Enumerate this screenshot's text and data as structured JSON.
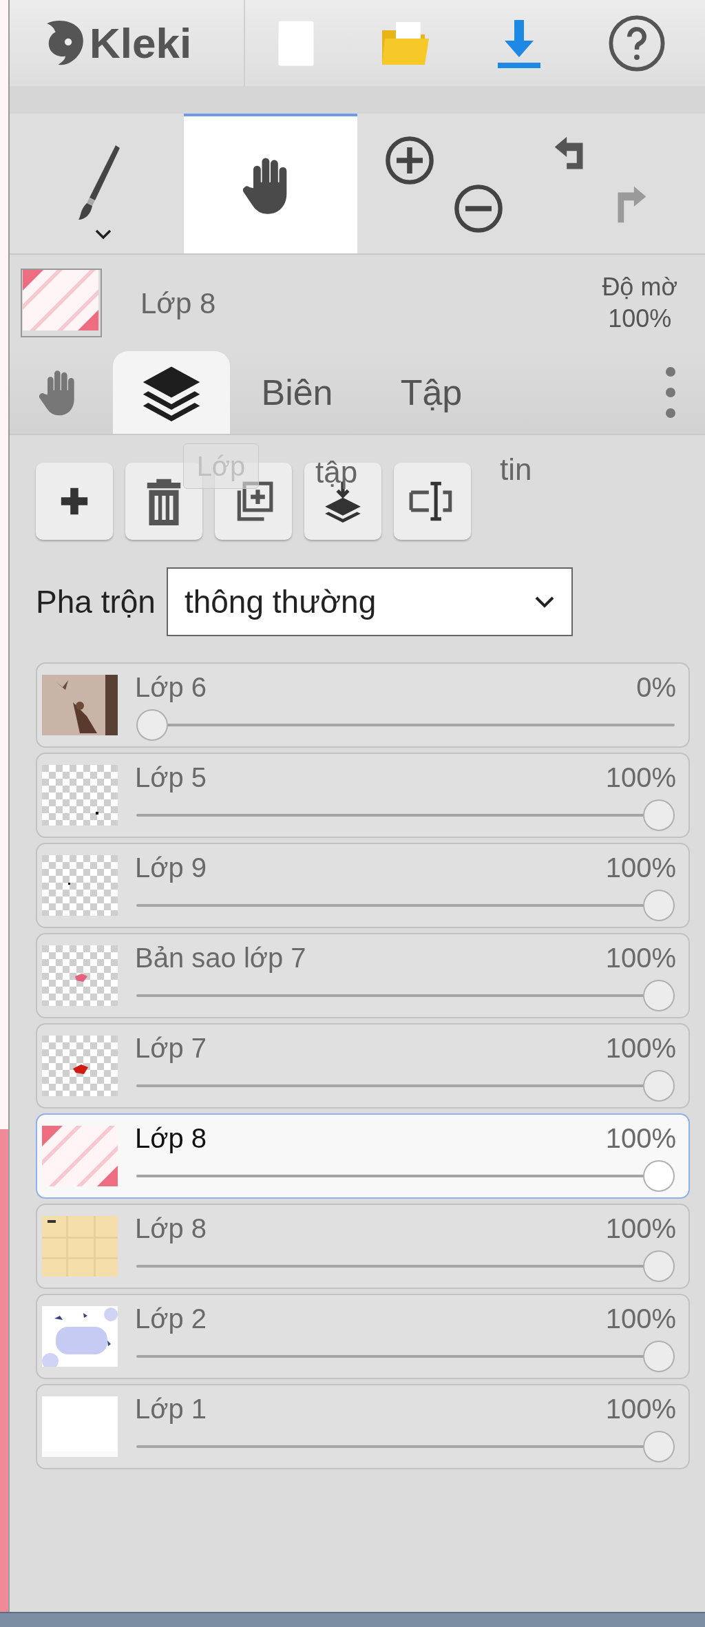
{
  "header": {
    "logo": "Kleki"
  },
  "tools": [
    {
      "kind": "brush",
      "selected": false
    },
    {
      "kind": "hand",
      "selected": true
    },
    {
      "kind": "zoom",
      "selected": false
    },
    {
      "kind": "history",
      "selected": false
    }
  ],
  "current_layer": {
    "name": "Lớp 8",
    "opacity_label": "Độ mờ",
    "opacity": "100%"
  },
  "tabs": [
    {
      "kind": "hand",
      "selected": false
    },
    {
      "kind": "layers",
      "selected": true
    },
    {
      "kind": "text",
      "label": "Biên",
      "selected": false
    },
    {
      "kind": "text",
      "label": "Tập",
      "selected": false
    },
    {
      "kind": "more",
      "selected": false
    }
  ],
  "tooltip": {
    "text": "Lớp"
  },
  "fragments": [
    "tập",
    "tin"
  ],
  "blend": {
    "label": "Pha trộn",
    "value": "thông thường"
  },
  "layers": [
    {
      "name": "Lớp 6",
      "opacity": "0%",
      "level": 0,
      "selected": false
    },
    {
      "name": "Lớp 5",
      "opacity": "100%",
      "level": 1,
      "selected": false
    },
    {
      "name": "Lớp 9",
      "opacity": "100%",
      "level": 1,
      "selected": false
    },
    {
      "name": "Bản sao lớp 7",
      "opacity": "100%",
      "level": 1,
      "selected": false
    },
    {
      "name": "Lớp 7",
      "opacity": "100%",
      "level": 1,
      "selected": false
    },
    {
      "name": "Lớp 8",
      "opacity": "100%",
      "level": 1,
      "selected": true
    },
    {
      "name": "Lớp 8",
      "opacity": "100%",
      "level": 1,
      "selected": false
    },
    {
      "name": "Lớp 2",
      "opacity": "100%",
      "level": 1,
      "selected": false
    },
    {
      "name": "Lớp 1",
      "opacity": "100%",
      "level": 1,
      "selected": false
    }
  ]
}
